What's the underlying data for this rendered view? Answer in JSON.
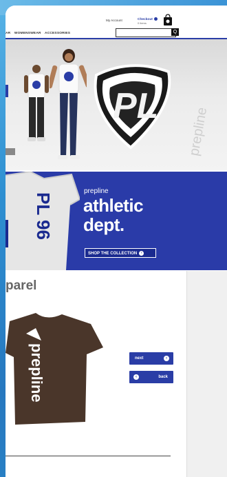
{
  "header": {
    "my_account": "My Account",
    "checkout": "Checkout",
    "items": "0 items",
    "search_placeholder": "",
    "search_button": "Q"
  },
  "nav": {
    "items": [
      "AR",
      "WOMENSWEAR",
      "ACCESSORIES"
    ]
  },
  "hero": {
    "logo_text": "PL",
    "wall_text": "prepline"
  },
  "banner": {
    "pre": "prepline",
    "line1": "athletic",
    "line2": "dept.",
    "button": "SHOP THE COLLECTION",
    "shirt_text": "PL 96"
  },
  "section": {
    "title": "parel",
    "tee_text": "prepline",
    "next": "next",
    "back": "back"
  },
  "colors": {
    "brand_blue": "#2a3da6",
    "banner_blue": "#2a3ba8",
    "tee_brown": "#4a362a"
  },
  "icons": {
    "bag": "shopping-bag-icon",
    "search": "search-icon",
    "next": "arrow-right-icon",
    "back": "arrow-left-icon"
  }
}
